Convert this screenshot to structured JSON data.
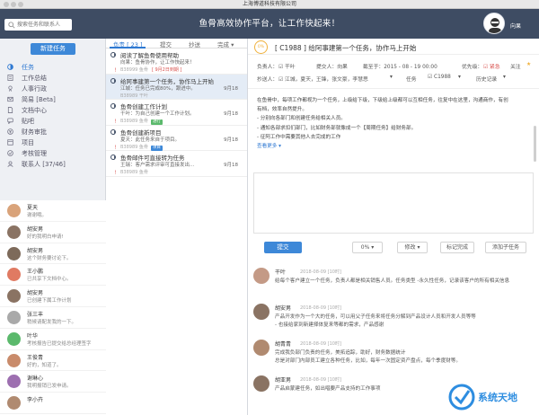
{
  "window": {
    "title": "上海博道科技有限公司"
  },
  "header": {
    "search_placeholder": "搜索任务和联系人",
    "slogan": "鱼骨高效协作平台，让工作快起来！",
    "username": "向果"
  },
  "sidebar": {
    "new_task": "新建任务",
    "nav": [
      {
        "label": "任务",
        "icon": "task-icon"
      },
      {
        "label": "工作总结",
        "icon": "summary-icon"
      },
      {
        "label": "人事行政",
        "icon": "hr-icon"
      },
      {
        "label": "简易 [Beta]",
        "icon": "simple-icon"
      },
      {
        "label": "文档中心",
        "icon": "document-icon"
      },
      {
        "label": "贴吧",
        "icon": "forum-icon"
      },
      {
        "label": "财务审批",
        "icon": "finance-icon"
      },
      {
        "label": "项目",
        "icon": "project-icon"
      },
      {
        "label": "考核管理",
        "icon": "assessment-icon"
      },
      {
        "label": "联系人 [37/46]",
        "icon": "contacts-icon"
      }
    ],
    "contacts": [
      {
        "name": "夏天",
        "msg": "谢谢哦。",
        "color": "#d9a37a"
      },
      {
        "name": "胡安男",
        "msg": "好的我明白申请!",
        "color": "#8a7363"
      },
      {
        "name": "胡安男",
        "msg": "这个财务要讨论下。",
        "color": "#7d6a5a"
      },
      {
        "name": "王小鹏",
        "msg": "已共享下文档中心。",
        "color": "#e07a62"
      },
      {
        "name": "胡安男",
        "msg": "已创建下属工作计划",
        "color": "#8a7363"
      },
      {
        "name": "张三丰",
        "msg": "稍候请配发我的一下。",
        "color": "#a9a9a9"
      },
      {
        "name": "叶华",
        "msg": "考核报告已提交给总经理签字",
        "color": "#5bb96c"
      },
      {
        "name": "王俊青",
        "msg": "好的，知道了。",
        "color": "#c98b6b"
      },
      {
        "name": "谢琳心",
        "msg": "我明报销已发申请。",
        "color": "#9d6fb0"
      },
      {
        "name": "李小卉",
        "msg": "",
        "color": "#b08a70"
      }
    ]
  },
  "tasklist": {
    "tabs": [
      "负责 [ 23 ]",
      "提交",
      "抄送",
      "完成 ▾"
    ],
    "tasks": [
      {
        "title": "阅读了解鱼骨使用帮助",
        "sub": "向果：鱼骨协作，让工作快起来！",
        "date": "",
        "alert": "！",
        "meta": "B38999 鱼骨",
        "badge": "[ 9月2日到期 ]",
        "badge_color": "#d9534f",
        "selected": false
      },
      {
        "title": "给阿事建第一个任务，协作马上开始",
        "sub": "江城：任务已完成80%，跟进中。",
        "date": "9月18",
        "alert": "",
        "meta": "B38989 干叶",
        "badge": "",
        "badge_color": "",
        "selected": true
      },
      {
        "title": "鱼骨创建工作计划",
        "sub": "干叶：为自己创建一个工作计划。",
        "date": "9月18",
        "alert": "！",
        "meta": "B38989 鱼骨",
        "badge": "进行",
        "badge_color": "#5bb96c",
        "selected": false
      },
      {
        "title": "鱼骨创建新项目",
        "sub": "夏天：此任务来自于项目。",
        "date": "9月18",
        "alert": "！",
        "meta": "B38989 鱼骨",
        "badge": "项目",
        "badge_color": "#3d88d8",
        "selected": false
      },
      {
        "title": "鱼骨邮件可直接转为任务",
        "sub": "王瑞：客户需求评审可直接发出…",
        "date": "9月18",
        "alert": "！",
        "meta": "B38989 鱼骨",
        "badge": "",
        "badge_color": "",
        "selected": false
      }
    ]
  },
  "detail": {
    "progress": "0%",
    "code": "[ C1988 ]",
    "title": "给阿事建第一个任务，协作马上开始",
    "info1": [
      "负责人：",
      "☑ 干叶",
      "提交人：向果",
      "截至于：2015 - 08 - 19 00:00",
      "优先级：",
      "☑ 紧急",
      "关注",
      "★"
    ],
    "info2": [
      "抄送人：",
      "☑ 江城，夏天，王锋，张文豪，李慧思",
      "▾",
      "任务",
      "☑ C1988",
      "▾",
      "历史记录",
      "▾"
    ],
    "desc": [
      "在鱼骨中，每项工作都视为一个任务，上级给下级，下级给上级都可以互相任务，往复中在这里，沟通商作，有创",
      "有档，效率自然提升。",
      "- 分别向各部门和创建任务给相关人员。",
      "- 通知各部求扣们部门，比如财务部就像成一个【周期任务】给财务部。",
      "- 征阿工作中需要其他人去完成的工作"
    ],
    "more": "查看更多 ▾",
    "buttons": {
      "submit": "提交",
      "progress": "0% ▾",
      "edit": "修改 ▾",
      "mark_done": "标记完成",
      "add_subtask": "添加子任务"
    },
    "comments": [
      {
        "name": "干叶",
        "time": "2018-08-09 [10时]",
        "line1": "给每个客户建立一个任务，负责人都是相关销售人员。任务类型 -永久性任务，记录该客户的所有相关信息",
        "line2": "",
        "color": "#c49a86"
      },
      {
        "name": "胡安男",
        "time": "2018-08-09 [10时]",
        "line1": "产品开发作为一个大的任务，可以用父子任务来将任务分解到产品设计人员和开发人员等等",
        "line2": "- 也接给家到新建择体复来等都的需求，产品感谢",
        "color": "#8a7363"
      },
      {
        "name": "胡青青",
        "time": "2018-08-09 [10时]",
        "line1": "完成我负部门负责的任务，美拓追踪，助好，财务数据统计",
        "line2": "总是对部门内部员工建立各种任务，比如，每年一次固定资产盘点，每个季度财等。",
        "color": "#b08a70"
      },
      {
        "name": "胡亚男",
        "time": "2018-08-09 [10时]",
        "line1": "产品启蒙建任务，如出唱要产品支持的工作事项",
        "line2": "",
        "color": "#8a7363"
      }
    ]
  },
  "watermark": {
    "text": "系统天地"
  }
}
